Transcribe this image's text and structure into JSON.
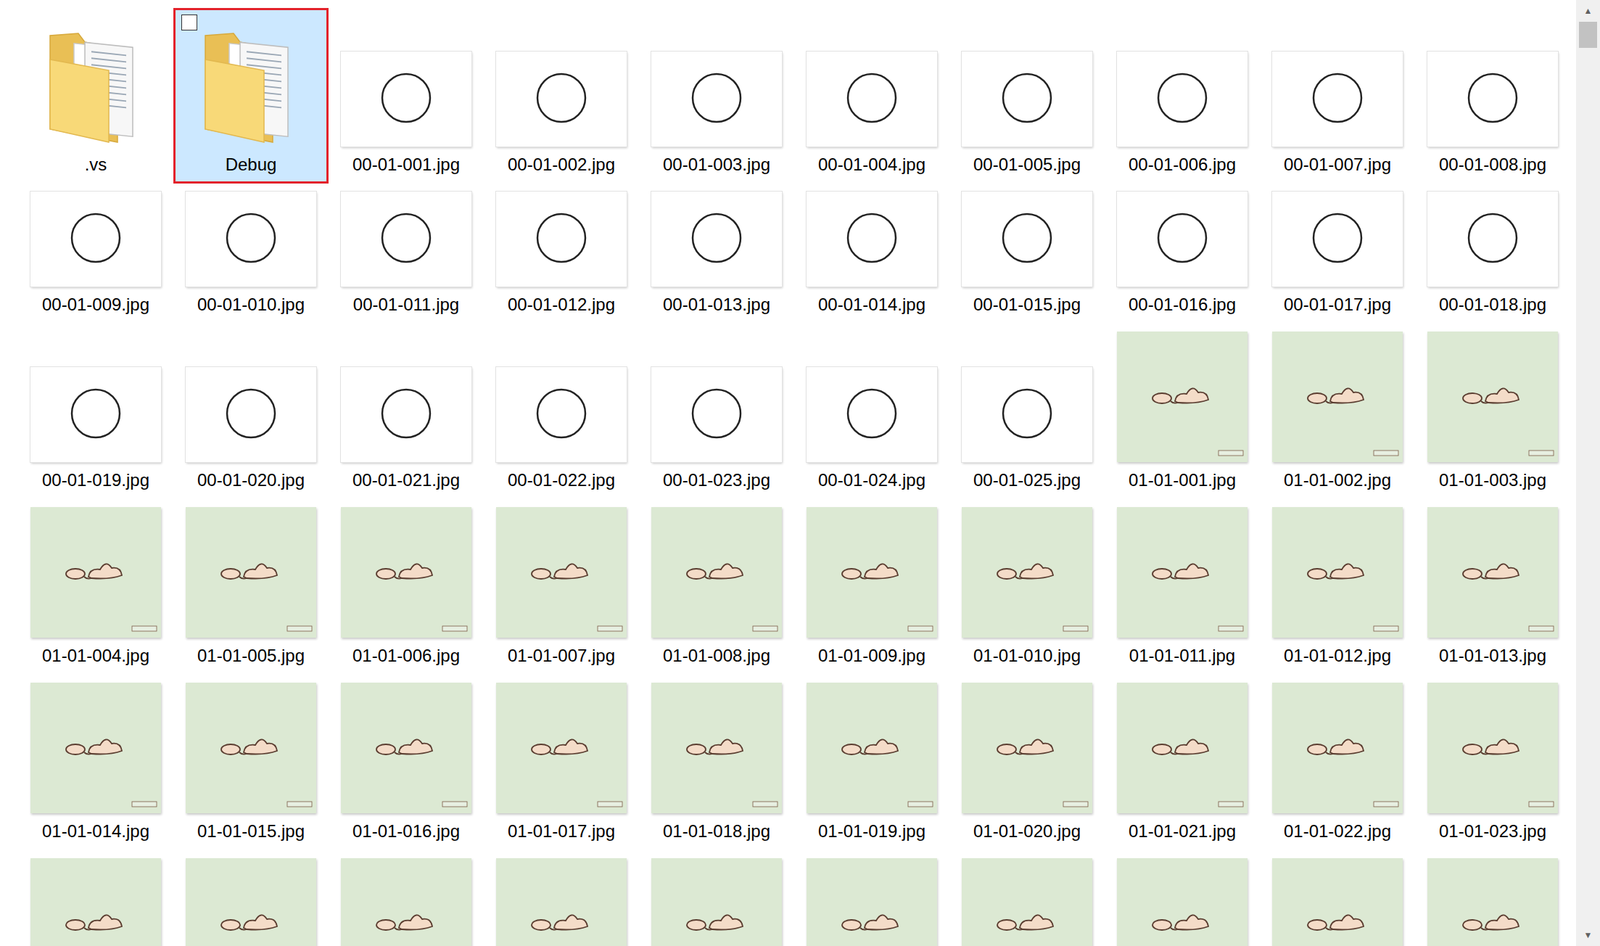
{
  "view": "large-icons",
  "items": [
    {
      "name": ".vs",
      "kind": "folder",
      "selected": false
    },
    {
      "name": "Debug",
      "kind": "folder",
      "selected": true,
      "checked": false
    },
    {
      "name": "00-01-001.jpg",
      "kind": "blank",
      "selected": false
    },
    {
      "name": "00-01-002.jpg",
      "kind": "blank",
      "selected": false
    },
    {
      "name": "00-01-003.jpg",
      "kind": "blank",
      "selected": false
    },
    {
      "name": "00-01-004.jpg",
      "kind": "blank",
      "selected": false
    },
    {
      "name": "00-01-005.jpg",
      "kind": "blank",
      "selected": false
    },
    {
      "name": "00-01-006.jpg",
      "kind": "blank",
      "selected": false
    },
    {
      "name": "00-01-007.jpg",
      "kind": "blank",
      "selected": false
    },
    {
      "name": "00-01-008.jpg",
      "kind": "blank",
      "selected": false
    },
    {
      "name": "00-01-009.jpg",
      "kind": "blank",
      "selected": false
    },
    {
      "name": "00-01-010.jpg",
      "kind": "blank",
      "selected": false
    },
    {
      "name": "00-01-011.jpg",
      "kind": "blank",
      "selected": false
    },
    {
      "name": "00-01-012.jpg",
      "kind": "blank",
      "selected": false
    },
    {
      "name": "00-01-013.jpg",
      "kind": "blank",
      "selected": false
    },
    {
      "name": "00-01-014.jpg",
      "kind": "blank",
      "selected": false
    },
    {
      "name": "00-01-015.jpg",
      "kind": "blank",
      "selected": false
    },
    {
      "name": "00-01-016.jpg",
      "kind": "blank",
      "selected": false
    },
    {
      "name": "00-01-017.jpg",
      "kind": "blank",
      "selected": false
    },
    {
      "name": "00-01-018.jpg",
      "kind": "blank",
      "selected": false
    },
    {
      "name": "00-01-019.jpg",
      "kind": "blank",
      "selected": false
    },
    {
      "name": "00-01-020.jpg",
      "kind": "blank",
      "selected": false
    },
    {
      "name": "00-01-021.jpg",
      "kind": "blank",
      "selected": false
    },
    {
      "name": "00-01-022.jpg",
      "kind": "blank",
      "selected": false
    },
    {
      "name": "00-01-023.jpg",
      "kind": "blank",
      "selected": false
    },
    {
      "name": "00-01-024.jpg",
      "kind": "blank",
      "selected": false
    },
    {
      "name": "00-01-025.jpg",
      "kind": "blank",
      "selected": false
    },
    {
      "name": "01-01-001.jpg",
      "kind": "green",
      "selected": false
    },
    {
      "name": "01-01-002.jpg",
      "kind": "green",
      "selected": false
    },
    {
      "name": "01-01-003.jpg",
      "kind": "green",
      "selected": false
    },
    {
      "name": "01-01-004.jpg",
      "kind": "green",
      "selected": false
    },
    {
      "name": "01-01-005.jpg",
      "kind": "green",
      "selected": false
    },
    {
      "name": "01-01-006.jpg",
      "kind": "green",
      "selected": false
    },
    {
      "name": "01-01-007.jpg",
      "kind": "green",
      "selected": false
    },
    {
      "name": "01-01-008.jpg",
      "kind": "green",
      "selected": false
    },
    {
      "name": "01-01-009.jpg",
      "kind": "green",
      "selected": false
    },
    {
      "name": "01-01-010.jpg",
      "kind": "green",
      "selected": false
    },
    {
      "name": "01-01-011.jpg",
      "kind": "green",
      "selected": false
    },
    {
      "name": "01-01-012.jpg",
      "kind": "green",
      "selected": false
    },
    {
      "name": "01-01-013.jpg",
      "kind": "green",
      "selected": false
    },
    {
      "name": "01-01-014.jpg",
      "kind": "green",
      "selected": false
    },
    {
      "name": "01-01-015.jpg",
      "kind": "green",
      "selected": false
    },
    {
      "name": "01-01-016.jpg",
      "kind": "green",
      "selected": false
    },
    {
      "name": "01-01-017.jpg",
      "kind": "green",
      "selected": false
    },
    {
      "name": "01-01-018.jpg",
      "kind": "green",
      "selected": false
    },
    {
      "name": "01-01-019.jpg",
      "kind": "green",
      "selected": false
    },
    {
      "name": "01-01-020.jpg",
      "kind": "green",
      "selected": false
    },
    {
      "name": "01-01-021.jpg",
      "kind": "green",
      "selected": false
    },
    {
      "name": "01-01-022.jpg",
      "kind": "green",
      "selected": false
    },
    {
      "name": "01-01-023.jpg",
      "kind": "green",
      "selected": false
    },
    {
      "name": "",
      "kind": "green",
      "selected": false
    },
    {
      "name": "",
      "kind": "green",
      "selected": false
    },
    {
      "name": "",
      "kind": "green",
      "selected": false
    },
    {
      "name": "",
      "kind": "green",
      "selected": false
    },
    {
      "name": "",
      "kind": "green",
      "selected": false
    },
    {
      "name": "",
      "kind": "green",
      "selected": false
    },
    {
      "name": "",
      "kind": "green",
      "selected": false
    },
    {
      "name": "",
      "kind": "green",
      "selected": false
    },
    {
      "name": "",
      "kind": "green",
      "selected": false
    },
    {
      "name": "",
      "kind": "green",
      "selected": false
    }
  ],
  "scrollbar": {
    "up": "▲",
    "down": "▼",
    "level": 0
  }
}
